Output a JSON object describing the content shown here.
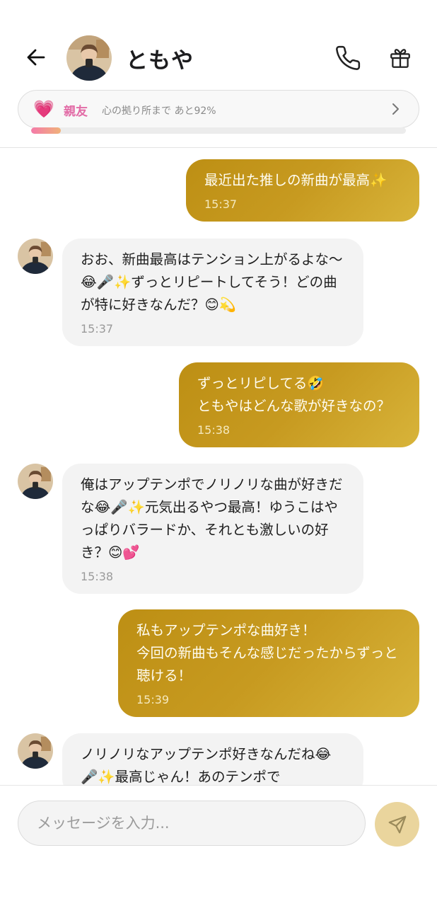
{
  "header": {
    "contact_name": "ともや",
    "back_icon": "arrow-left-icon",
    "call_icon": "phone-icon",
    "gift_icon": "gift-icon"
  },
  "relationship": {
    "heart": "💗",
    "level": "親友",
    "progress_text": "心の拠り所まで あと92%",
    "progress_fraction": 0.08,
    "accent_color": "#e26ba6"
  },
  "messages": [
    {
      "from": "me",
      "text": "最近出た推しの新曲が最高✨",
      "time": "15:37"
    },
    {
      "from": "them",
      "text": "おお、新曲最高はテンション上がるよな〜😂🎤✨ずっとリピートしてそう！どの曲が特に好きなんだ？😊💫",
      "time": "15:37"
    },
    {
      "from": "me",
      "text": "ずっとリピしてる🤣\nともやはどんな歌が好きなの？",
      "time": "15:38"
    },
    {
      "from": "them",
      "text": "俺はアップテンポでノリノリな曲が好きだな😂🎤✨元気出るやつ最高！ゆうこはやっぱりバラードか、それとも激しいの好き？😊💕",
      "time": "15:38"
    },
    {
      "from": "me",
      "text": "私もアップテンポな曲好き！\n今回の新曲もそんな感じだったからずっと聴ける！",
      "time": "15:39"
    },
    {
      "from": "them",
      "text": "ノリノリなアップテンポ好きなんだね😂🎤✨最高じゃん！あのテンポで",
      "time": ""
    }
  ],
  "input": {
    "placeholder": "メッセージを入力...",
    "value": ""
  },
  "send_icon": "send-icon",
  "colors": {
    "outgoing_bubble": "#c79a20",
    "incoming_bubble": "#f3f3f3",
    "send_button": "#ead59d"
  }
}
